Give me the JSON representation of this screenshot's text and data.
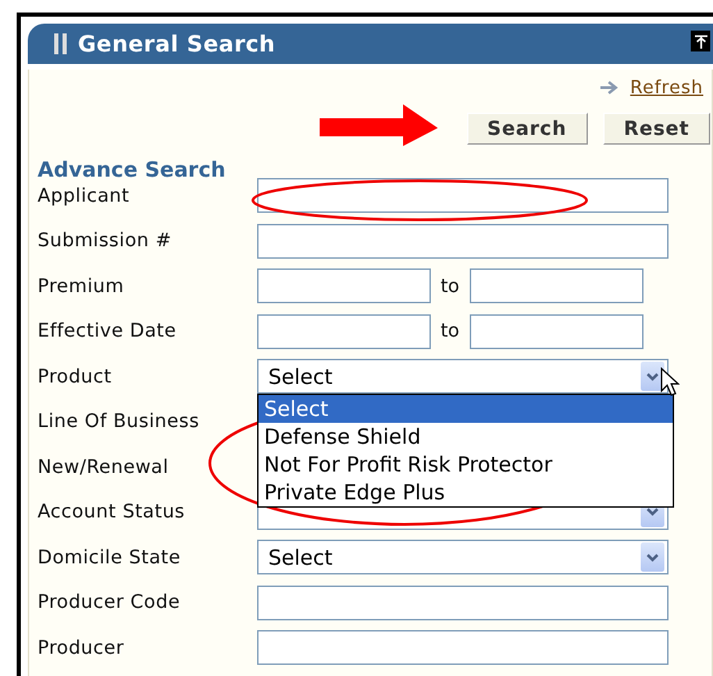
{
  "panel": {
    "title": "General Search",
    "refresh_link": "Refresh"
  },
  "buttons": [
    {
      "label": "Search"
    },
    {
      "label": "Reset"
    }
  ],
  "section_title": "Advance Search",
  "fields": [
    {
      "label": "Applicant",
      "kind": "text"
    },
    {
      "label": "Submission #",
      "kind": "text"
    },
    {
      "label": "Premium",
      "kind": "range",
      "separator": "to"
    },
    {
      "label": "Effective Date",
      "kind": "range",
      "separator": "to"
    },
    {
      "label": "Product",
      "kind": "select",
      "value": "Select",
      "open": true,
      "options": [
        {
          "label": "Select",
          "selected": true
        },
        {
          "label": "Defense Shield",
          "selected": false
        },
        {
          "label": "Not For Profit Risk Protector",
          "selected": false
        },
        {
          "label": "Private Edge Plus",
          "selected": false
        }
      ]
    },
    {
      "label": "Line Of Business",
      "kind": "covered"
    },
    {
      "label": "New/Renewal",
      "kind": "covered"
    },
    {
      "label": "Account Status",
      "kind": "select"
    },
    {
      "label": "Domicile State",
      "kind": "select",
      "value": "Select"
    },
    {
      "label": "Producer Code",
      "kind": "text"
    },
    {
      "label": "Producer",
      "kind": "text"
    }
  ]
}
